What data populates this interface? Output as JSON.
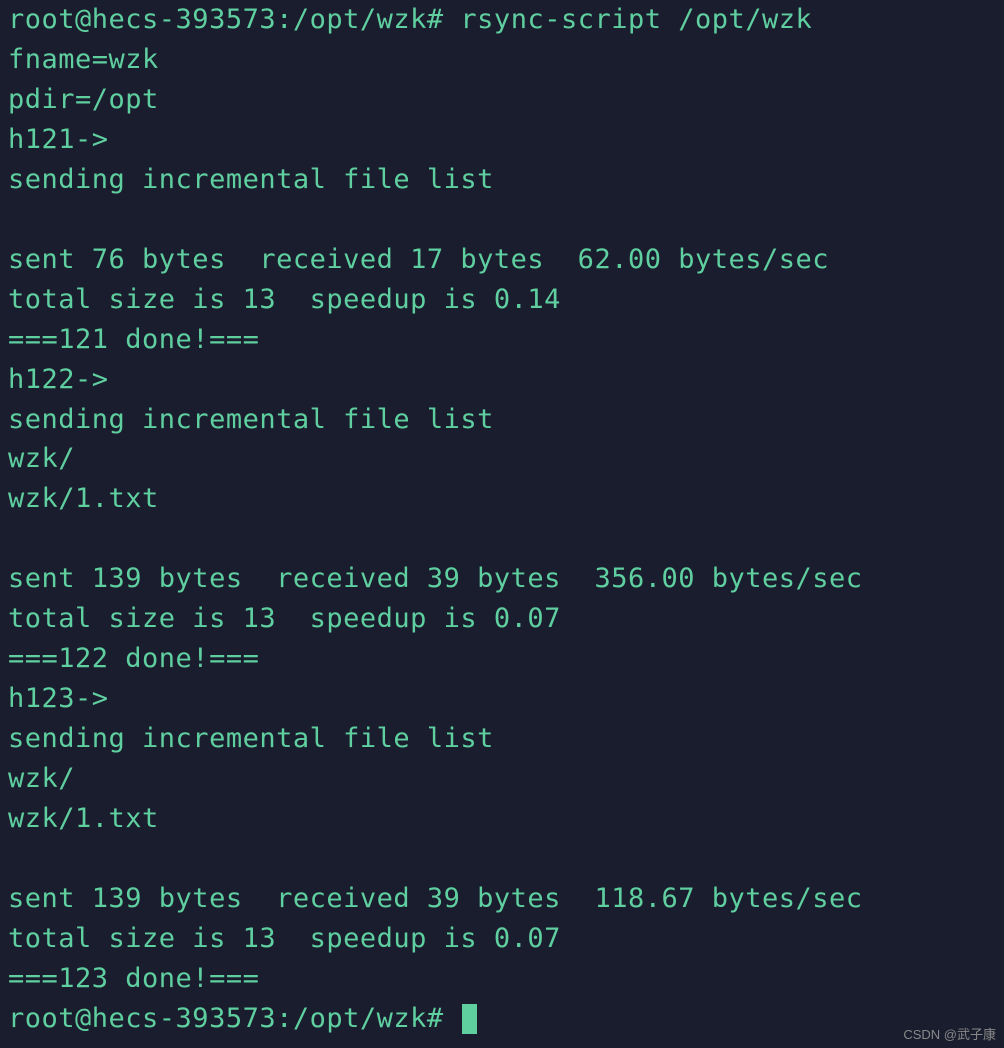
{
  "prompt1": {
    "user_host": "root@hecs-393573",
    "path": ":/opt/wzk#",
    "command": "rsync-script /opt/wzk"
  },
  "output": {
    "l1": "fname=wzk",
    "l2": "pdir=/opt",
    "l3": "h121->",
    "l4": "sending incremental file list",
    "l5": "",
    "l6": "sent 76 bytes  received 17 bytes  62.00 bytes/sec",
    "l7": "total size is 13  speedup is 0.14",
    "l8": "===121 done!===",
    "l9": "h122->",
    "l10": "sending incremental file list",
    "l11": "wzk/",
    "l12": "wzk/1.txt",
    "l13": "",
    "l14": "sent 139 bytes  received 39 bytes  356.00 bytes/sec",
    "l15": "total size is 13  speedup is 0.07",
    "l16": "===122 done!===",
    "l17": "h123->",
    "l18": "sending incremental file list",
    "l19": "wzk/",
    "l20": "wzk/1.txt",
    "l21": "",
    "l22": "sent 139 bytes  received 39 bytes  118.67 bytes/sec",
    "l23": "total size is 13  speedup is 0.07",
    "l24": "===123 done!==="
  },
  "prompt2": {
    "user_host": "root@hecs-393573",
    "path": ":/opt/wzk#"
  },
  "watermark": "CSDN @武子康"
}
